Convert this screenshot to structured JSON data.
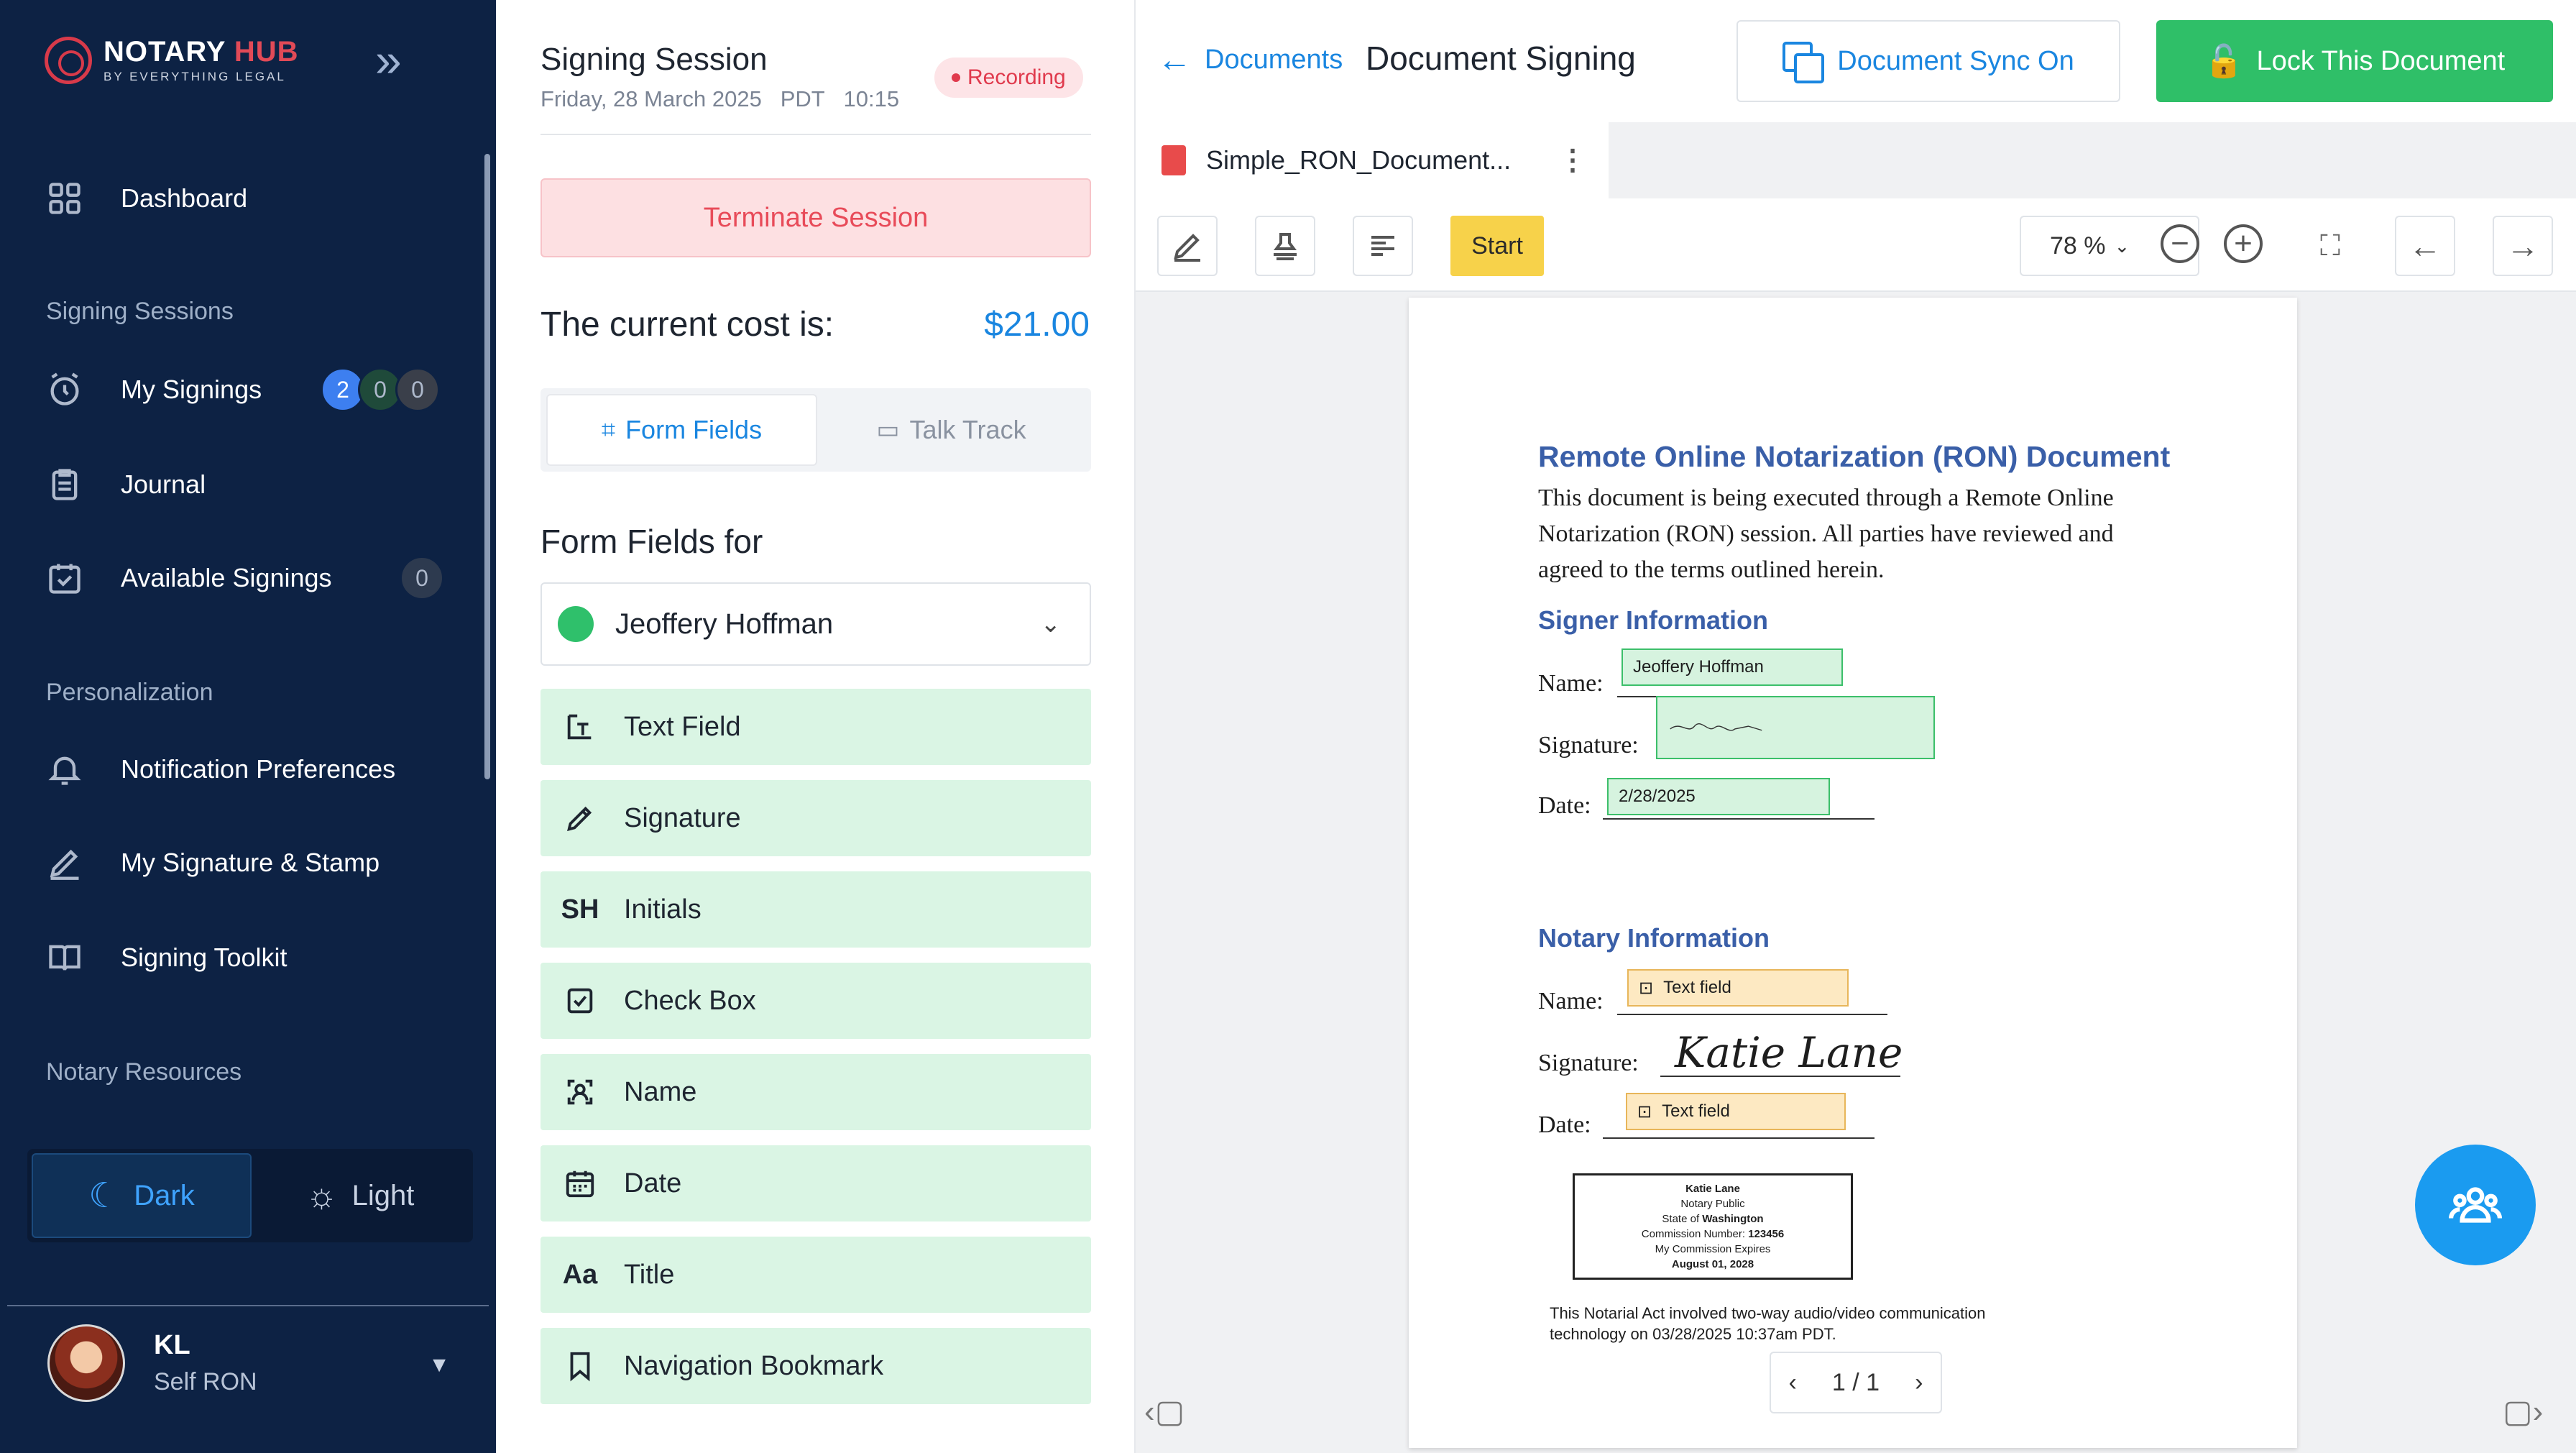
{
  "brand": {
    "name": "NOTARY",
    "name_accent": "HUB",
    "tagline": "BY EVERYTHING LEGAL"
  },
  "sidebar": {
    "items": [
      {
        "label": "Dashboard",
        "icon": "grid-icon"
      },
      {
        "label": "My Signings",
        "icon": "alarm-icon",
        "badges": [
          "2",
          "0",
          "0"
        ]
      },
      {
        "label": "Journal",
        "icon": "clipboard-icon"
      },
      {
        "label": "Available Signings",
        "icon": "calendar-check-icon",
        "count": "0"
      },
      {
        "label": "Notification Preferences",
        "icon": "bell-icon"
      },
      {
        "label": "My Signature & Stamp",
        "icon": "pen-icon"
      },
      {
        "label": "Signing Toolkit",
        "icon": "book-icon"
      }
    ],
    "sections": {
      "signing": "Signing Sessions",
      "personalization": "Personalization",
      "resources": "Notary Resources"
    },
    "theme": {
      "dark": "Dark",
      "light": "Light"
    },
    "user": {
      "initials": "KL",
      "role": "Self RON"
    },
    "badge_colors": [
      "#3d7ff0",
      "#1f4a3a",
      "#3a3f4a"
    ]
  },
  "session": {
    "title": "Signing Session",
    "date": "Friday, 28 March 2025",
    "tz": "PDT",
    "time": "10:15",
    "status": "Recording",
    "terminate_label": "Terminate Session",
    "cost_label": "The current cost is:",
    "cost_value": "$21.00",
    "tabs": [
      "Form Fields",
      "Talk Track"
    ],
    "form_fields_heading": "Form Fields for",
    "signer": "Jeoffery Hoffman",
    "fields": [
      {
        "label": "Text Field",
        "icon": "text-field-icon"
      },
      {
        "label": "Signature",
        "icon": "signature-pen-icon"
      },
      {
        "label": "Initials",
        "icon": "initials-icon",
        "glyph": "SH"
      },
      {
        "label": "Check Box",
        "icon": "checkbox-icon"
      },
      {
        "label": "Name",
        "icon": "name-icon"
      },
      {
        "label": "Date",
        "icon": "date-icon"
      },
      {
        "label": "Title",
        "icon": "title-icon",
        "glyph": "Aa"
      },
      {
        "label": "Navigation Bookmark",
        "icon": "bookmark-icon"
      }
    ]
  },
  "viewer": {
    "back_label": "Documents",
    "title": "Document Signing",
    "sync_label": "Document Sync On",
    "lock_label": "Lock This Document",
    "file_name": "Simple_RON_Document...",
    "start_label": "Start",
    "zoom": "78 %",
    "pager": "1 / 1",
    "accent": "#1a86e0",
    "lock_color": "#2fbf68"
  },
  "document": {
    "heading": "Remote Online Notarization (RON) Document",
    "intro": "This document is being executed through a Remote Online Notarization (RON) session. All parties have reviewed and agreed to the terms outlined herein.",
    "signer_heading": "Signer Information",
    "notary_heading": "Notary Information",
    "name_label": "Name:",
    "signature_label": "Signature:",
    "date_label": "Date:",
    "signer_name_value": "Jeoffery Hoffman",
    "signer_date_value": "2/28/2025",
    "text_field_placeholder": "Text field",
    "notary_signature": "Katie Lane",
    "stamp": {
      "name": "Katie Lane",
      "title": "Notary Public",
      "state_prefix": "State of",
      "state": "Washington",
      "commission_prefix": "Commission Number:",
      "commission": "123456",
      "expires_label": "My Commission Expires",
      "expires": "August 01, 2028"
    },
    "notarial_act": "This Notarial Act involved two-way audio/video communication technology on 03/28/2025 10:37am PDT."
  }
}
